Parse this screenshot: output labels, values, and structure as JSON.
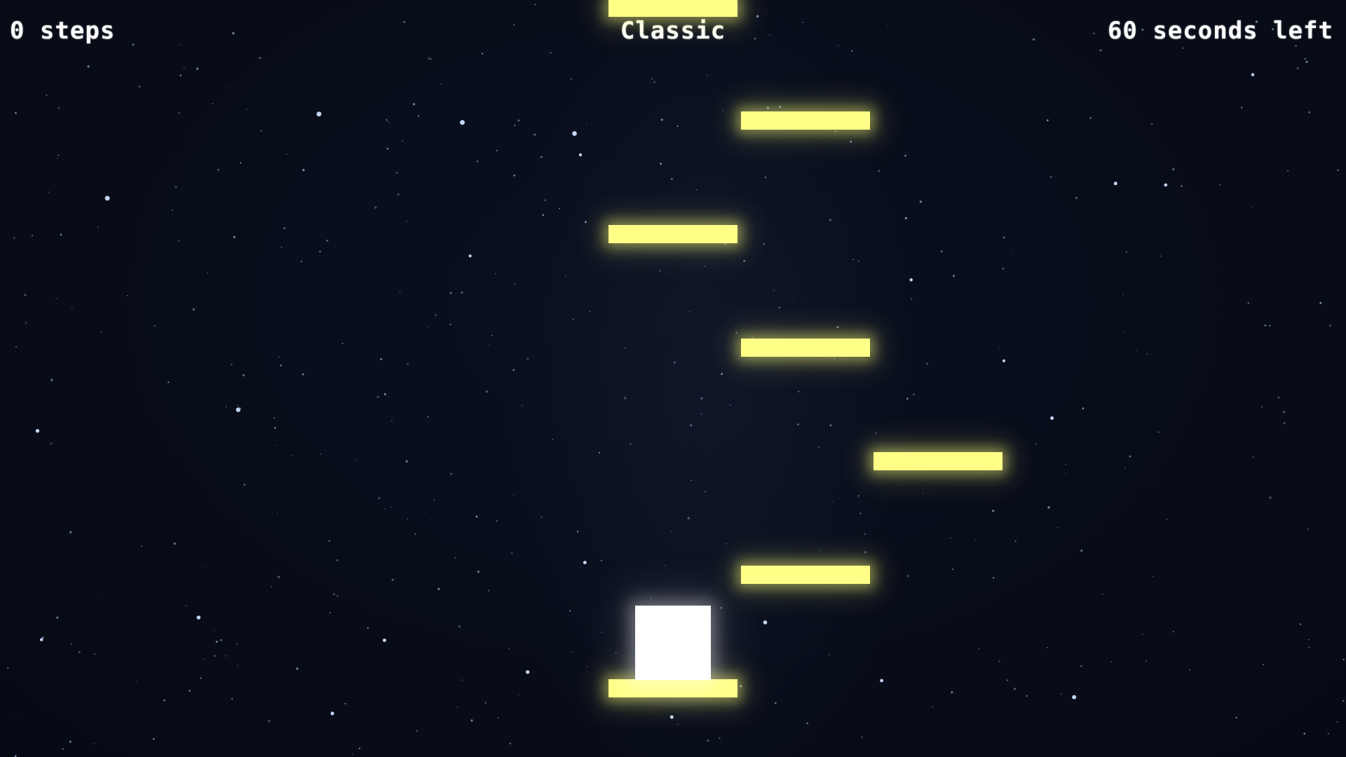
{
  "hud": {
    "steps": "0 steps",
    "mode": "Classic",
    "timer": "60 seconds left"
  },
  "colors": {
    "background": "#070b16",
    "platform": "#ffff88",
    "player": "#ffffff",
    "text": "#ffffff"
  }
}
